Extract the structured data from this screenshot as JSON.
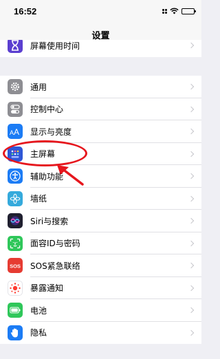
{
  "status_bar": {
    "time": "16:52"
  },
  "nav": {
    "title": "设置"
  },
  "top_item": {
    "label": "屏幕使用时间",
    "icon": "hourglass-icon",
    "color": "#5b3fd0"
  },
  "items": [
    {
      "label": "通用",
      "icon": "gear-icon",
      "color": "#8e8e93"
    },
    {
      "label": "控制中心",
      "icon": "toggles-icon",
      "color": "#8e8e93"
    },
    {
      "label": "显示与亮度",
      "icon": "text-size-icon",
      "color": "#1c7cf5"
    },
    {
      "label": "主屏幕",
      "icon": "app-grid-icon",
      "color": "#2f57d6"
    },
    {
      "label": "辅助功能",
      "icon": "accessibility-icon",
      "color": "#1c7cf5"
    },
    {
      "label": "墙纸",
      "icon": "flower-icon",
      "color": "#35aadc"
    },
    {
      "label": "Siri与搜索",
      "icon": "siri-icon",
      "color": "#202030"
    },
    {
      "label": "面容ID与密码",
      "icon": "face-id-icon",
      "color": "#2fc75a"
    },
    {
      "label": "SOS紧急联络",
      "icon": "sos-icon",
      "color": "#e63b32"
    },
    {
      "label": "暴露通知",
      "icon": "exposure-icon",
      "color": "#ffffff"
    },
    {
      "label": "电池",
      "icon": "battery-icon",
      "color": "#2fc75a"
    },
    {
      "label": "隐私",
      "icon": "hand-icon",
      "color": "#1c7cf5"
    }
  ],
  "annotation": {
    "highlight_color": "#e6161d"
  }
}
